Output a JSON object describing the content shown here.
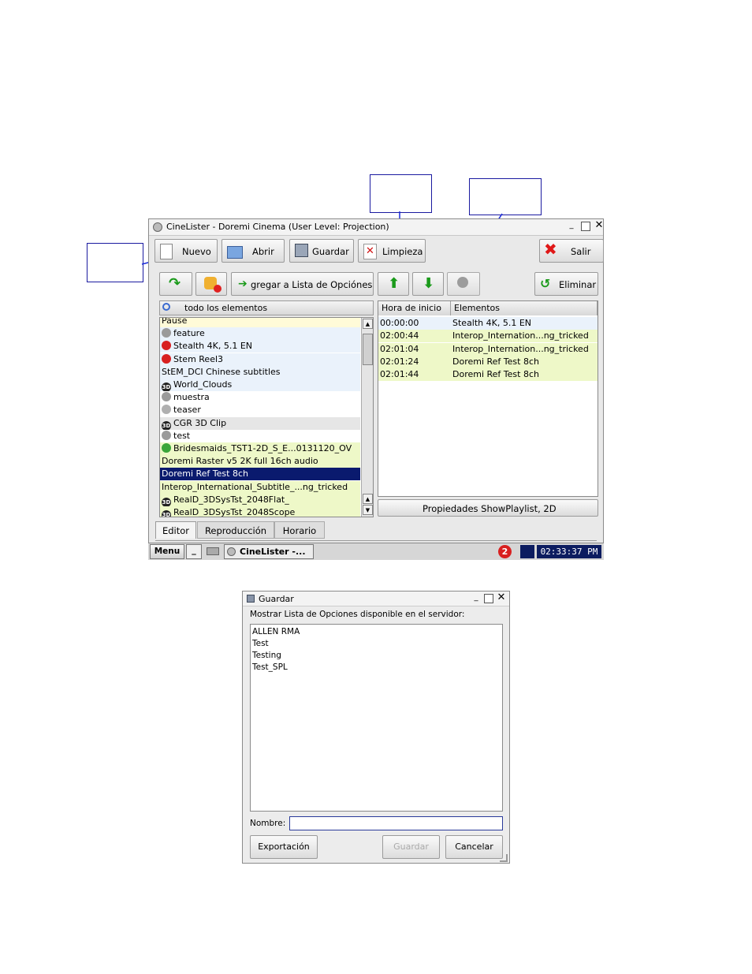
{
  "window": {
    "title": "CineLister - Doremi Cinema (User Level: Projection)",
    "toolbar": {
      "nuevo": "Nuevo",
      "abrir": "Abrir",
      "guardar": "Guardar",
      "limpieza": "Limpieza",
      "salir": "Salir"
    },
    "toolbar2": {
      "add_label": "gregar a Lista de Opciónes",
      "eliminar": "Eliminar"
    },
    "left_panel": {
      "filter_label": "todo los elementos",
      "items": [
        {
          "label": "Pause",
          "icon": "none",
          "bg": "#fffbd8"
        },
        {
          "label": "feature",
          "icon": "film",
          "bg": "#eaf2fb"
        },
        {
          "label": "Stealth 4K, 5.1 EN",
          "icon": "red",
          "bg": "#eaf2fb"
        },
        {
          "label": "Stem Reel3",
          "icon": "red",
          "bg": "#eaf2fb"
        },
        {
          "label": "StEM_DCI Chinese subtitles",
          "icon": "none",
          "bg": "#eaf2fb"
        },
        {
          "label": "World_Clouds",
          "icon": "3d",
          "bg": "#eaf2fb"
        },
        {
          "label": "muestra",
          "icon": "film",
          "bg": "#ffffff"
        },
        {
          "label": "teaser",
          "icon": "gear",
          "bg": "#ffffff"
        },
        {
          "label": "CGR 3D Clip",
          "icon": "3d",
          "bg": "#e6e6e6"
        },
        {
          "label": "test",
          "icon": "film",
          "bg": "#ffffff"
        },
        {
          "label": "Bridesmaids_TST1-2D_S_E...0131120_OV",
          "icon": "green",
          "bg": "#eef8c8"
        },
        {
          "label": "Doremi Raster v5 2K full 16ch audio",
          "icon": "none",
          "bg": "#eef8c8"
        },
        {
          "label": "Doremi Ref Test 8ch",
          "icon": "none",
          "bg": "#0a1a6e",
          "selected": true
        },
        {
          "label": "Interop_International_Subtitle_...ng_tricked",
          "icon": "none",
          "bg": "#eef8c8"
        },
        {
          "label": "RealD_3DSysTst_2048Flat_",
          "icon": "3d",
          "bg": "#eef8c8"
        },
        {
          "label": "RealD_3DSysTst_2048Scope",
          "icon": "3d",
          "bg": "#eef8c8"
        }
      ]
    },
    "right_panel": {
      "col_start": "Hora de inicio",
      "col_items": "Elementos",
      "rows": [
        {
          "time": "00:00:00",
          "item": "Stealth 4K, 5.1 EN",
          "bg": "#eaf2fb"
        },
        {
          "time": "02:00:44",
          "item": "Interop_Internation...ng_tricked",
          "bg": "#eef8c8"
        },
        {
          "time": "02:01:04",
          "item": "Interop_Internation...ng_tricked",
          "bg": "#eef8c8"
        },
        {
          "time": "02:01:24",
          "item": "Doremi Ref Test 8ch",
          "bg": "#eef8c8"
        },
        {
          "time": "02:01:44",
          "item": "Doremi Ref Test 8ch",
          "bg": "#eef8c8"
        }
      ],
      "properties": "Propiedades ShowPlaylist, 2D"
    },
    "tabs": [
      "Editor",
      "Reproducción",
      "Horario"
    ]
  },
  "taskbar": {
    "menu": "Menu",
    "minimize": "_",
    "task": "CineLister -...",
    "badge": "2",
    "clock": "02:33:37 PM"
  },
  "dialog": {
    "title": "Guardar",
    "prompt": "Mostrar Lista de Opciones disponible en el servidor:",
    "items": [
      "ALLEN RMA",
      "Test",
      "Testing",
      "Test_SPL"
    ],
    "name_label": "Nombre:",
    "name_value": "",
    "export": "Exportación",
    "save": "Guardar",
    "cancel": "Cancelar"
  }
}
